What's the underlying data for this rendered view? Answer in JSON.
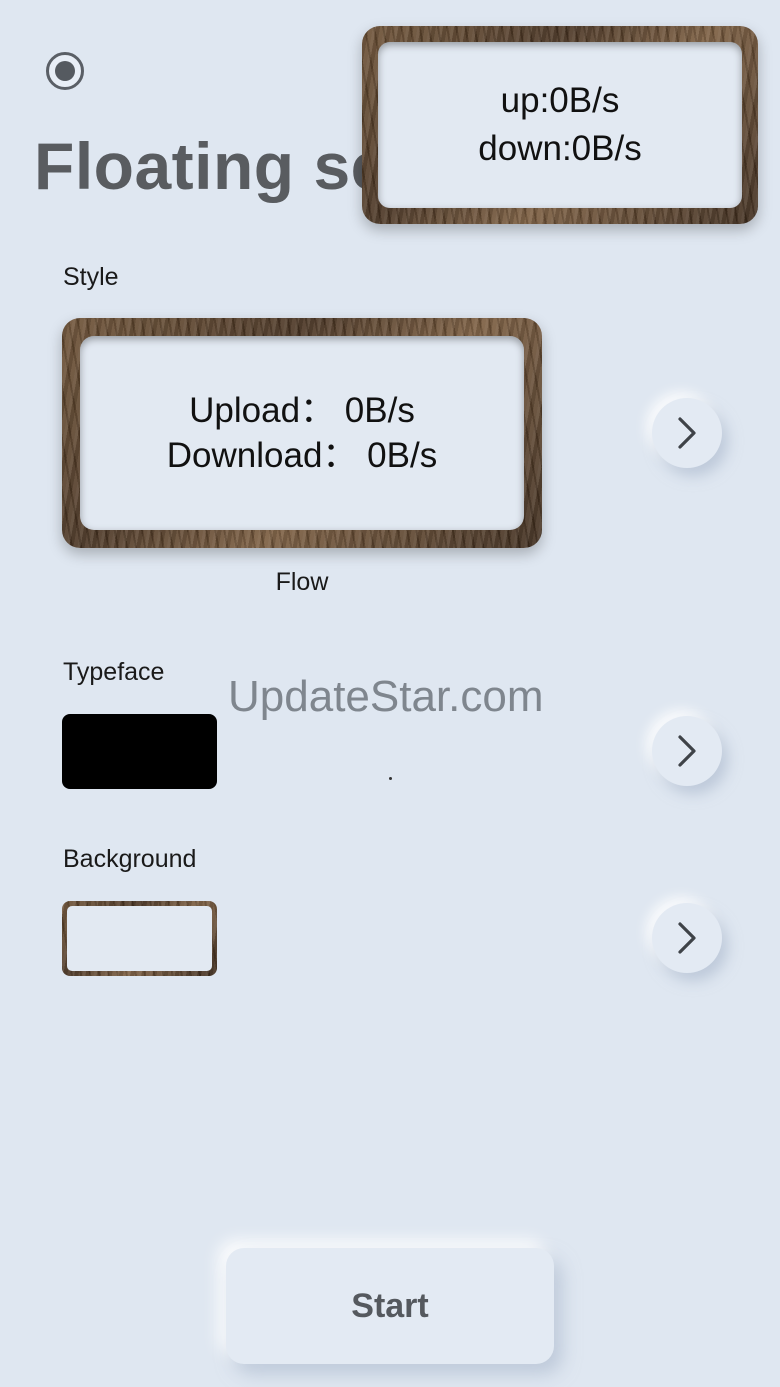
{
  "header": {
    "title": "Floating se"
  },
  "floating_window": {
    "up_text": "up:0B/s",
    "down_text": "down:0B/s"
  },
  "style_section": {
    "label": "Style",
    "preview_upload": "Upload： 0B/s",
    "preview_download": "Download： 0B/s",
    "style_name": "Flow"
  },
  "typeface_section": {
    "label": "Typeface",
    "swatch_color": "#000000"
  },
  "background_section": {
    "label": "Background"
  },
  "watermark": "UpdateStar.com",
  "start_button": {
    "label": "Start"
  },
  "icons": {
    "radio": "radio-selected-icon",
    "chevron": "chevron-right-icon"
  },
  "colors": {
    "page_background": "#dfe7f1",
    "title_color": "#595c60",
    "wood_frame": "#5a4029"
  }
}
